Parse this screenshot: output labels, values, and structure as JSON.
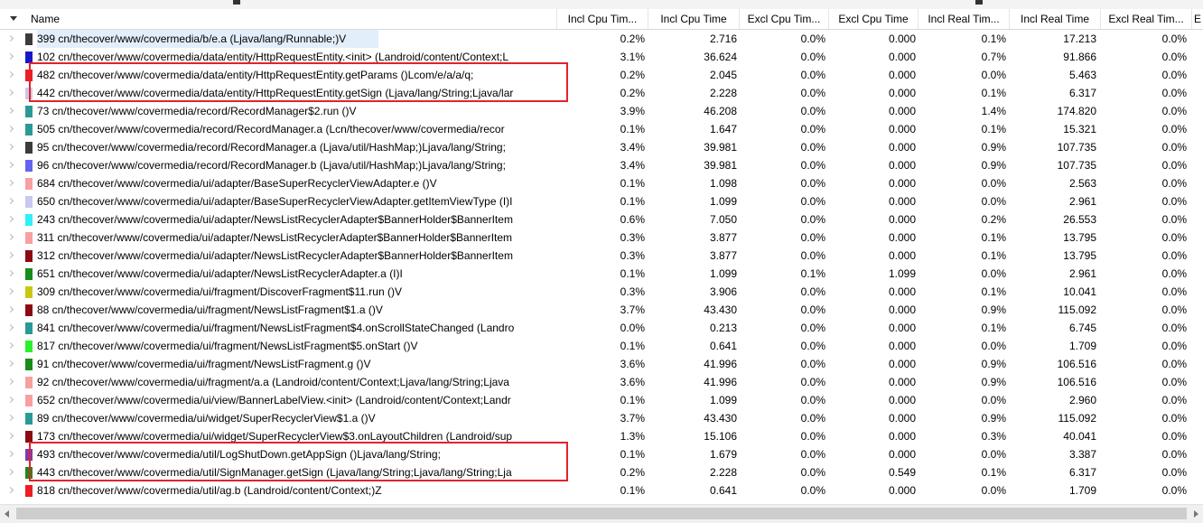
{
  "columns": {
    "name": "Name",
    "incl_cpu_pct": "Incl Cpu Tim...",
    "incl_cpu_time": "Incl Cpu Time",
    "excl_cpu_pct": "Excl Cpu Tim...",
    "excl_cpu_time": "Excl Cpu Time",
    "incl_real_pct": "Incl Real Tim...",
    "incl_real_time": "Incl Real Time",
    "excl_real_pct": "Excl Real Tim...",
    "extra": "E"
  },
  "rows": [
    {
      "name": "399 cn/thecover/www/covermedia/b/e.a (Ljava/lang/Runnable;)V",
      "color": "#3c3c3c",
      "incl_cpu_pct": "0.2%",
      "incl_cpu_time": "2.716",
      "excl_cpu_pct": "0.0%",
      "excl_cpu_time": "0.000",
      "incl_real_pct": "0.1%",
      "incl_real_time": "17.213",
      "excl_real_pct": "0.0%"
    },
    {
      "name": "102 cn/thecover/www/covermedia/data/entity/HttpRequestEntity.<init> (Landroid/content/Context;L",
      "color": "#1818c8",
      "incl_cpu_pct": "3.1%",
      "incl_cpu_time": "36.624",
      "excl_cpu_pct": "0.0%",
      "excl_cpu_time": "0.000",
      "incl_real_pct": "0.7%",
      "incl_real_time": "91.866",
      "excl_real_pct": "0.0%"
    },
    {
      "name": "482 cn/thecover/www/covermedia/data/entity/HttpRequestEntity.getParams ()Lcom/e/a/a/q;",
      "color": "#ee1c24",
      "incl_cpu_pct": "0.2%",
      "incl_cpu_time": "2.045",
      "excl_cpu_pct": "0.0%",
      "excl_cpu_time": "0.000",
      "incl_real_pct": "0.0%",
      "incl_real_time": "5.463",
      "excl_real_pct": "0.0%"
    },
    {
      "name": "442 cn/thecover/www/covermedia/data/entity/HttpRequestEntity.getSign (Ljava/lang/String;Ljava/lar",
      "color": "#ccc8e8",
      "incl_cpu_pct": "0.2%",
      "incl_cpu_time": "2.228",
      "excl_cpu_pct": "0.0%",
      "excl_cpu_time": "0.000",
      "incl_real_pct": "0.1%",
      "incl_real_time": "6.317",
      "excl_real_pct": "0.0%"
    },
    {
      "name": "73 cn/thecover/www/covermedia/record/RecordManager$2.run ()V",
      "color": "#2a9a96",
      "incl_cpu_pct": "3.9%",
      "incl_cpu_time": "46.208",
      "excl_cpu_pct": "0.0%",
      "excl_cpu_time": "0.000",
      "incl_real_pct": "1.4%",
      "incl_real_time": "174.820",
      "excl_real_pct": "0.0%"
    },
    {
      "name": "505 cn/thecover/www/covermedia/record/RecordManager.a (Lcn/thecover/www/covermedia/recor",
      "color": "#2a9a96",
      "incl_cpu_pct": "0.1%",
      "incl_cpu_time": "1.647",
      "excl_cpu_pct": "0.0%",
      "excl_cpu_time": "0.000",
      "incl_real_pct": "0.1%",
      "incl_real_time": "15.321",
      "excl_real_pct": "0.0%"
    },
    {
      "name": "95 cn/thecover/www/covermedia/record/RecordManager.a (Ljava/util/HashMap;)Ljava/lang/String;",
      "color": "#3c3c3c",
      "incl_cpu_pct": "3.4%",
      "incl_cpu_time": "39.981",
      "excl_cpu_pct": "0.0%",
      "excl_cpu_time": "0.000",
      "incl_real_pct": "0.9%",
      "incl_real_time": "107.735",
      "excl_real_pct": "0.0%"
    },
    {
      "name": "96 cn/thecover/www/covermedia/record/RecordManager.b (Ljava/util/HashMap;)Ljava/lang/String;",
      "color": "#6464f0",
      "incl_cpu_pct": "3.4%",
      "incl_cpu_time": "39.981",
      "excl_cpu_pct": "0.0%",
      "excl_cpu_time": "0.000",
      "incl_real_pct": "0.9%",
      "incl_real_time": "107.735",
      "excl_real_pct": "0.0%"
    },
    {
      "name": "684 cn/thecover/www/covermedia/ui/adapter/BaseSuperRecyclerViewAdapter.e ()V",
      "color": "#f8a0a0",
      "incl_cpu_pct": "0.1%",
      "incl_cpu_time": "1.098",
      "excl_cpu_pct": "0.0%",
      "excl_cpu_time": "0.000",
      "incl_real_pct": "0.0%",
      "incl_real_time": "2.563",
      "excl_real_pct": "0.0%"
    },
    {
      "name": "650 cn/thecover/www/covermedia/ui/adapter/BaseSuperRecyclerViewAdapter.getItemViewType (I)I",
      "color": "#c8c8f0",
      "incl_cpu_pct": "0.1%",
      "incl_cpu_time": "1.099",
      "excl_cpu_pct": "0.0%",
      "excl_cpu_time": "0.000",
      "incl_real_pct": "0.0%",
      "incl_real_time": "2.961",
      "excl_real_pct": "0.0%"
    },
    {
      "name": "243 cn/thecover/www/covermedia/ui/adapter/NewsListRecyclerAdapter$BannerHolder$BannerItem",
      "color": "#30f0f8",
      "incl_cpu_pct": "0.6%",
      "incl_cpu_time": "7.050",
      "excl_cpu_pct": "0.0%",
      "excl_cpu_time": "0.000",
      "incl_real_pct": "0.2%",
      "incl_real_time": "26.553",
      "excl_real_pct": "0.0%"
    },
    {
      "name": "311 cn/thecover/www/covermedia/ui/adapter/NewsListRecyclerAdapter$BannerHolder$BannerItem",
      "color": "#f8a0a0",
      "incl_cpu_pct": "0.3%",
      "incl_cpu_time": "3.877",
      "excl_cpu_pct": "0.0%",
      "excl_cpu_time": "0.000",
      "incl_real_pct": "0.1%",
      "incl_real_time": "13.795",
      "excl_real_pct": "0.0%"
    },
    {
      "name": "312 cn/thecover/www/covermedia/ui/adapter/NewsListRecyclerAdapter$BannerHolder$BannerItem",
      "color": "#8c0a14",
      "incl_cpu_pct": "0.3%",
      "incl_cpu_time": "3.877",
      "excl_cpu_pct": "0.0%",
      "excl_cpu_time": "0.000",
      "incl_real_pct": "0.1%",
      "incl_real_time": "13.795",
      "excl_real_pct": "0.0%"
    },
    {
      "name": "651 cn/thecover/www/covermedia/ui/adapter/NewsListRecyclerAdapter.a (I)I",
      "color": "#188c18",
      "incl_cpu_pct": "0.1%",
      "incl_cpu_time": "1.099",
      "excl_cpu_pct": "0.1%",
      "excl_cpu_time": "1.099",
      "incl_real_pct": "0.0%",
      "incl_real_time": "2.961",
      "excl_real_pct": "0.0%"
    },
    {
      "name": "309 cn/thecover/www/covermedia/ui/fragment/DiscoverFragment$11.run ()V",
      "color": "#c8c814",
      "incl_cpu_pct": "0.3%",
      "incl_cpu_time": "3.906",
      "excl_cpu_pct": "0.0%",
      "excl_cpu_time": "0.000",
      "incl_real_pct": "0.1%",
      "incl_real_time": "10.041",
      "excl_real_pct": "0.0%"
    },
    {
      "name": "88 cn/thecover/www/covermedia/ui/fragment/NewsListFragment$1.a ()V",
      "color": "#8c0a14",
      "incl_cpu_pct": "3.7%",
      "incl_cpu_time": "43.430",
      "excl_cpu_pct": "0.0%",
      "excl_cpu_time": "0.000",
      "incl_real_pct": "0.9%",
      "incl_real_time": "115.092",
      "excl_real_pct": "0.0%"
    },
    {
      "name": "841 cn/thecover/www/covermedia/ui/fragment/NewsListFragment$4.onScrollStateChanged (Landro",
      "color": "#2a9a96",
      "incl_cpu_pct": "0.0%",
      "incl_cpu_time": "0.213",
      "excl_cpu_pct": "0.0%",
      "excl_cpu_time": "0.000",
      "incl_real_pct": "0.1%",
      "incl_real_time": "6.745",
      "excl_real_pct": "0.0%"
    },
    {
      "name": "817 cn/thecover/www/covermedia/ui/fragment/NewsListFragment$5.onStart ()V",
      "color": "#2cf02c",
      "incl_cpu_pct": "0.1%",
      "incl_cpu_time": "0.641",
      "excl_cpu_pct": "0.0%",
      "excl_cpu_time": "0.000",
      "incl_real_pct": "0.0%",
      "incl_real_time": "1.709",
      "excl_real_pct": "0.0%"
    },
    {
      "name": "91 cn/thecover/www/covermedia/ui/fragment/NewsListFragment.g ()V",
      "color": "#188c18",
      "incl_cpu_pct": "3.6%",
      "incl_cpu_time": "41.996",
      "excl_cpu_pct": "0.0%",
      "excl_cpu_time": "0.000",
      "incl_real_pct": "0.9%",
      "incl_real_time": "106.516",
      "excl_real_pct": "0.0%"
    },
    {
      "name": "92 cn/thecover/www/covermedia/ui/fragment/a.a (Landroid/content/Context;Ljava/lang/String;Ljava",
      "color": "#f8a0a0",
      "incl_cpu_pct": "3.6%",
      "incl_cpu_time": "41.996",
      "excl_cpu_pct": "0.0%",
      "excl_cpu_time": "0.000",
      "incl_real_pct": "0.9%",
      "incl_real_time": "106.516",
      "excl_real_pct": "0.0%"
    },
    {
      "name": "652 cn/thecover/www/covermedia/ui/view/BannerLabelView.<init> (Landroid/content/Context;Landr",
      "color": "#f8a0a0",
      "incl_cpu_pct": "0.1%",
      "incl_cpu_time": "1.099",
      "excl_cpu_pct": "0.0%",
      "excl_cpu_time": "0.000",
      "incl_real_pct": "0.0%",
      "incl_real_time": "2.960",
      "excl_real_pct": "0.0%"
    },
    {
      "name": "89 cn/thecover/www/covermedia/ui/widget/SuperRecyclerView$1.a ()V",
      "color": "#2a9a96",
      "incl_cpu_pct": "3.7%",
      "incl_cpu_time": "43.430",
      "excl_cpu_pct": "0.0%",
      "excl_cpu_time": "0.000",
      "incl_real_pct": "0.9%",
      "incl_real_time": "115.092",
      "excl_real_pct": "0.0%"
    },
    {
      "name": "173 cn/thecover/www/covermedia/ui/widget/SuperRecyclerView$3.onLayoutChildren (Landroid/sup",
      "color": "#8c0a14",
      "incl_cpu_pct": "1.3%",
      "incl_cpu_time": "15.106",
      "excl_cpu_pct": "0.0%",
      "excl_cpu_time": "0.000",
      "incl_real_pct": "0.3%",
      "incl_real_time": "40.041",
      "excl_real_pct": "0.0%"
    },
    {
      "name": "493 cn/thecover/www/covermedia/util/LogShutDown.getAppSign ()Ljava/lang/String;",
      "color": "#7a3cb4",
      "incl_cpu_pct": "0.1%",
      "incl_cpu_time": "1.679",
      "excl_cpu_pct": "0.0%",
      "excl_cpu_time": "0.000",
      "incl_real_pct": "0.0%",
      "incl_real_time": "3.387",
      "excl_real_pct": "0.0%"
    },
    {
      "name": "443 cn/thecover/www/covermedia/util/SignManager.getSign (Ljava/lang/String;Ljava/lang/String;Lja",
      "color": "#188c18",
      "incl_cpu_pct": "0.2%",
      "incl_cpu_time": "2.228",
      "excl_cpu_pct": "0.0%",
      "excl_cpu_time": "0.549",
      "incl_real_pct": "0.1%",
      "incl_real_time": "6.317",
      "excl_real_pct": "0.0%"
    },
    {
      "name": "818 cn/thecover/www/covermedia/util/ag.b (Landroid/content/Context;)Z",
      "color": "#ee1c24",
      "incl_cpu_pct": "0.1%",
      "incl_cpu_time": "0.641",
      "excl_cpu_pct": "0.0%",
      "excl_cpu_time": "0.000",
      "incl_real_pct": "0.0%",
      "incl_real_time": "1.709",
      "excl_real_pct": "0.0%"
    }
  ],
  "highlights": {
    "box1_color": "#e0242b",
    "box2_color": "#e0242b"
  }
}
